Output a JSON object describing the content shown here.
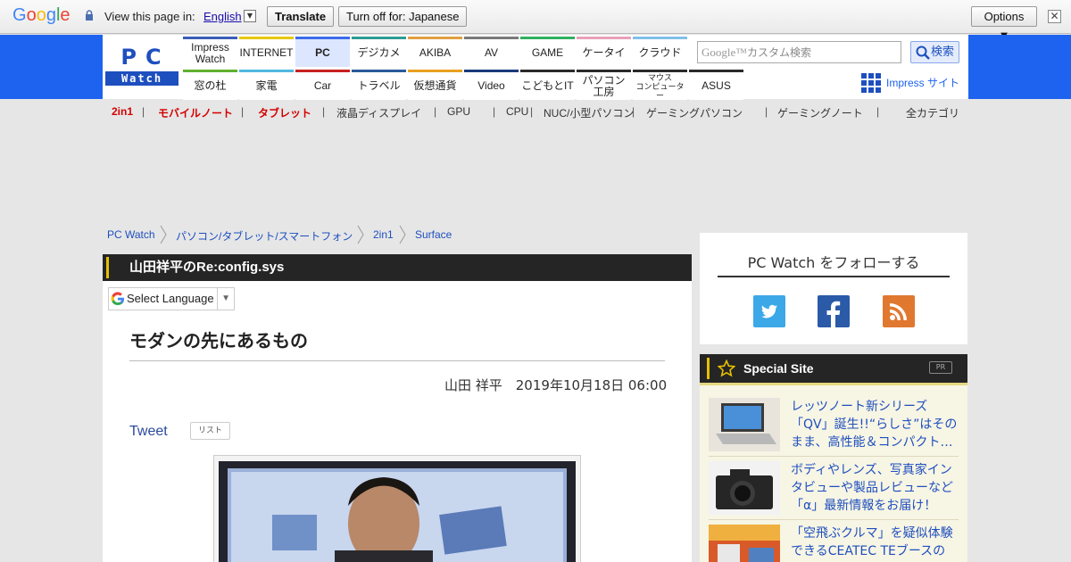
{
  "translate_bar": {
    "logo": "Google",
    "view_text": "View this page in:",
    "language": "English",
    "translate_label": "Translate",
    "turn_off_label": "Turn off for: Japanese",
    "options_label": "Options ▼",
    "close_glyph": "✕"
  },
  "header": {
    "logo_pc": "PC",
    "logo_watch": "Watch",
    "nav_top": [
      {
        "label": "Impress\nWatch",
        "color": "#3a5db8"
      },
      {
        "label": "INTERNET",
        "color": "#e8c800"
      },
      {
        "label": "PC",
        "color": "#3c6ce8"
      },
      {
        "label": "デジカメ",
        "color": "#2e9c92"
      },
      {
        "label": "AKIBA",
        "color": "#e0a040"
      },
      {
        "label": "AV",
        "color": "#7a7a7a"
      },
      {
        "label": "GAME",
        "color": "#30b060"
      },
      {
        "label": "ケータイ",
        "color": "#e8a0b8"
      },
      {
        "label": "クラウド",
        "color": "#80c0e8"
      }
    ],
    "nav_bottom": [
      {
        "label": "窓の杜",
        "color": "#60b030"
      },
      {
        "label": "家電",
        "color": "#50b8e0"
      },
      {
        "label": "Car",
        "color": "#c82020"
      },
      {
        "label": "トラベル",
        "color": "#2a5a9a"
      },
      {
        "label": "仮想通貨",
        "color": "#e8a020"
      },
      {
        "label": "Video",
        "color": "#1a3a7a"
      },
      {
        "label": "こどもとIT",
        "color": "#2a2a2a"
      },
      {
        "label": "パソコン\n工房",
        "color": "#2a2a2a"
      },
      {
        "label": "マウス\nコンピューター",
        "color": "#2a2a2a"
      },
      {
        "label": "ASUS",
        "color": "#2a2a2a"
      }
    ],
    "search_placeholder_brand": "Google™",
    "search_placeholder": "カスタム検索",
    "search_button": "検索",
    "impress_site": "Impress サイト"
  },
  "categories": [
    {
      "label": "2in1",
      "highlight": true
    },
    {
      "label": "モバイルノート",
      "highlight": true
    },
    {
      "label": "タブレット",
      "highlight": true
    },
    {
      "label": "液晶ディスプレイ",
      "highlight": false
    },
    {
      "label": "GPU",
      "highlight": false
    },
    {
      "label": "CPU",
      "highlight": false
    },
    {
      "label": "NUC/小型パソコン",
      "highlight": false
    },
    {
      "label": "ゲーミングパソコン",
      "highlight": false
    },
    {
      "label": "ゲーミングノート",
      "highlight": false
    }
  ],
  "all_categories": "全カテゴリ",
  "breadcrumb": [
    "PC Watch",
    "パソコン/タブレット/スマートフォン",
    "2in1",
    "Surface"
  ],
  "article": {
    "series": "山田祥平のRe:config.sys",
    "language_select": "Select Language",
    "title": "モダンの先にあるもの",
    "byline": "山田 祥平　2019年10月18日 06:00",
    "tweet": "Tweet",
    "list_tag": "リスト"
  },
  "sidebar": {
    "follow_title": "PC Watch をフォローする",
    "special_title": "Special Site",
    "pr": "PR",
    "items": [
      {
        "text": "レッツノート新シリーズ「QV」誕生!!“らしさ”はそのまま、高性能＆コンパクト…"
      },
      {
        "text": "ボディやレンズ、写真家インタビューや製品レビューなど「α」最新情報をお届け！"
      },
      {
        "text": "「空飛ぶクルマ」を疑似体験できるCEATEC TEブースの"
      }
    ]
  },
  "colors": {
    "brand_blue": "#1e63f0",
    "twitter": "#3ca8e8",
    "facebook": "#2a5aa8",
    "rss": "#e07830",
    "accent_yellow": "#e6c000"
  }
}
